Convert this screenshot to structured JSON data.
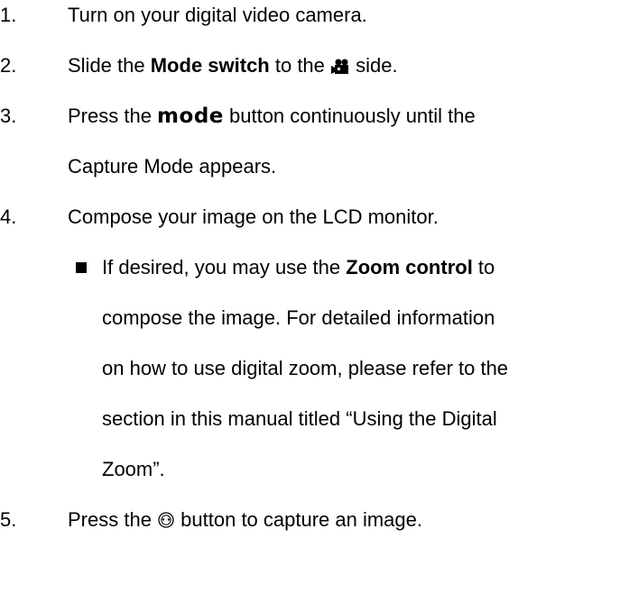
{
  "steps": [
    {
      "num": "1.",
      "text": "Turn on your digital video camera."
    },
    {
      "num": "2.",
      "pre": "Slide the ",
      "bold": "Mode switch",
      "mid": " to the ",
      "icon": "movie-camera-icon",
      "post": " side."
    },
    {
      "num": "3.",
      "pre": "Press the ",
      "mode_word": "mode",
      "post": " button continuously until the",
      "cont": "Capture Mode appears."
    },
    {
      "num": "4.",
      "text": "Compose your image on the LCD monitor."
    },
    {
      "num": "5.",
      "pre": "Press the ",
      "icon": "shutter-button-icon",
      "post": " button to capture an image."
    }
  ],
  "bullet": {
    "pre": "If desired, you may use the ",
    "bold": "Zoom control",
    "post": " to",
    "lines": [
      "compose the image. For detailed information",
      "on how to use digital zoom, please refer to the",
      "section in this manual titled “Using the Digital",
      "Zoom”."
    ]
  }
}
